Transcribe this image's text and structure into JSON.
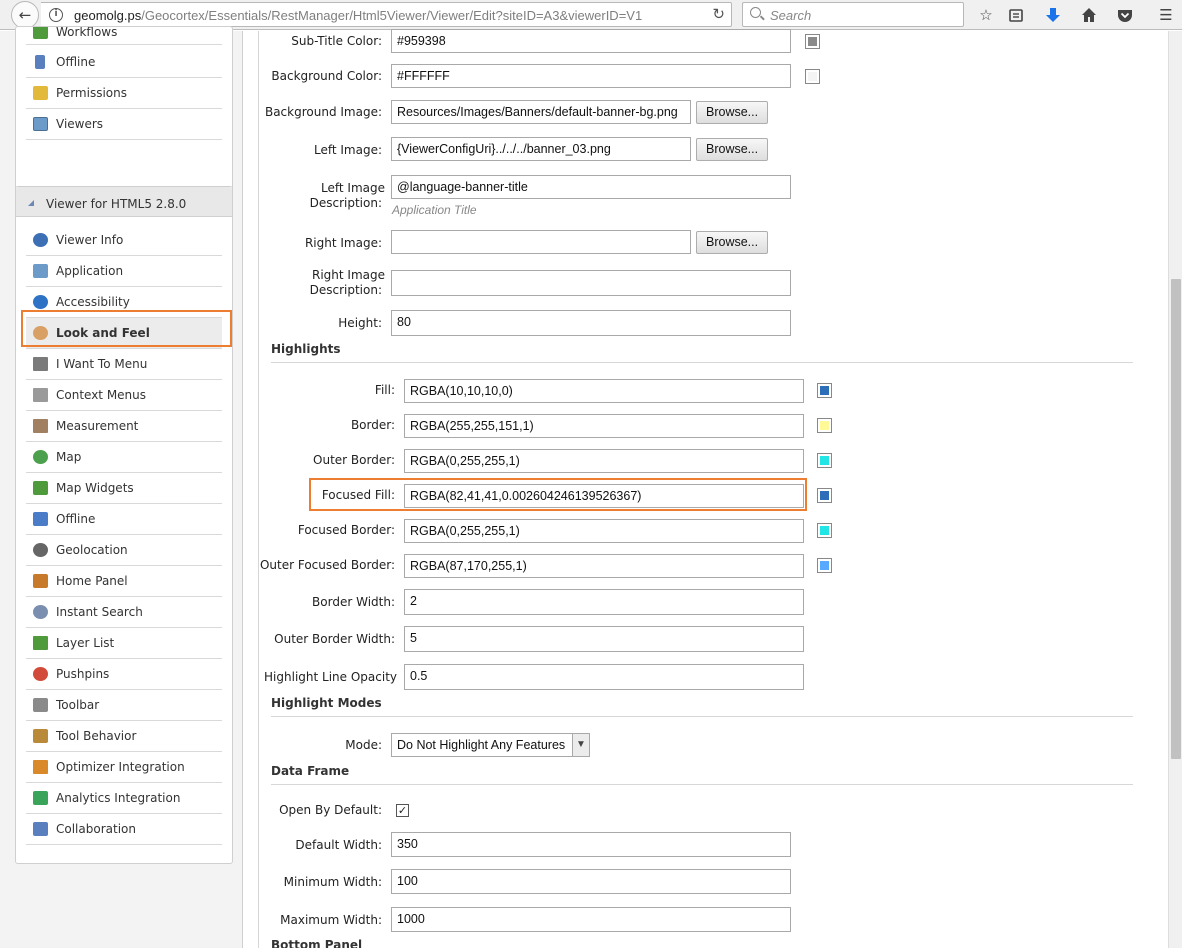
{
  "browser": {
    "url_host": "geomolg.ps",
    "url_path": "/Geocortex/Essentials/RestManager/Html5Viewer/Viewer/Edit?siteID=A3&viewerID=V1",
    "search_placeholder": "Search"
  },
  "sidebar": {
    "top_items": [
      {
        "label": "Workflows"
      },
      {
        "label": "Offline"
      },
      {
        "label": "Permissions"
      },
      {
        "label": "Viewers"
      }
    ],
    "panel_title": "Viewer for HTML5 2.8.0",
    "items": [
      {
        "label": "Viewer Info"
      },
      {
        "label": "Application"
      },
      {
        "label": "Accessibility"
      },
      {
        "label": "Look and Feel"
      },
      {
        "label": "I Want To Menu"
      },
      {
        "label": "Context Menus"
      },
      {
        "label": "Measurement"
      },
      {
        "label": "Map"
      },
      {
        "label": "Map Widgets"
      },
      {
        "label": "Offline"
      },
      {
        "label": "Geolocation"
      },
      {
        "label": "Home Panel"
      },
      {
        "label": "Instant Search"
      },
      {
        "label": "Layer List"
      },
      {
        "label": "Pushpins"
      },
      {
        "label": "Toolbar"
      },
      {
        "label": "Tool Behavior"
      },
      {
        "label": "Optimizer Integration"
      },
      {
        "label": "Analytics Integration"
      },
      {
        "label": "Collaboration"
      }
    ]
  },
  "banner": {
    "subtitle_color_label": "Sub-Title Color:",
    "subtitle_color_value": "#959398",
    "bg_color_label": "Background Color:",
    "bg_color_value": "#FFFFFF",
    "bg_image_label": "Background Image:",
    "bg_image_value": "Resources/Images/Banners/default-banner-bg.png",
    "left_image_label": "Left Image:",
    "left_image_value": "{ViewerConfigUri}../../../banner_03.png",
    "left_desc_label_1": "Left Image",
    "left_desc_label_2": "Description:",
    "left_desc_value": "@language-banner-title",
    "left_desc_hint": "Application Title",
    "right_image_label": "Right Image:",
    "right_image_value": "",
    "right_desc_label_1": "Right Image",
    "right_desc_label_2": "Description:",
    "right_desc_value": "",
    "height_label": "Height:",
    "height_value": "80",
    "browse_label": "Browse..."
  },
  "highlights": {
    "title": "Highlights",
    "fill_label": "Fill:",
    "fill_value": "RGBA(10,10,10,0)",
    "border_label": "Border:",
    "border_value": "RGBA(255,255,151,1)",
    "outer_border_label": "Outer Border:",
    "outer_border_value": "RGBA(0,255,255,1)",
    "focused_fill_label": "Focused Fill:",
    "focused_fill_value": "RGBA(82,41,41,0.002604246139526367)",
    "focused_border_label": "Focused Border:",
    "focused_border_value": "RGBA(0,255,255,1)",
    "outer_focused_border_label": "Outer Focused Border:",
    "outer_focused_border_value": "RGBA(87,170,255,1)",
    "border_width_label": "Border Width:",
    "border_width_value": "2",
    "outer_border_width_label": "Outer Border Width:",
    "outer_border_width_value": "5",
    "line_opacity_label": "Highlight Line Opacity",
    "line_opacity_value": "0.5"
  },
  "highlight_modes": {
    "title": "Highlight Modes",
    "mode_label": "Mode:",
    "mode_value": "Do Not Highlight Any Features"
  },
  "data_frame": {
    "title": "Data Frame",
    "open_label": "Open By Default:",
    "default_width_label": "Default Width:",
    "default_width_value": "350",
    "min_width_label": "Minimum Width:",
    "min_width_value": "100",
    "max_width_label": "Maximum Width:",
    "max_width_value": "1000",
    "next_section": "Bottom Panel"
  },
  "colors": {
    "accent_highlight": "#ED7D31",
    "swatch_gray": "#8a8a8a",
    "swatch_white": "#f4f4f4",
    "swatch_blue": "#2c6fb8",
    "swatch_yellow": "#fffa97",
    "swatch_cyan": "#22e6e6",
    "swatch_lightblue": "#57aaff"
  }
}
